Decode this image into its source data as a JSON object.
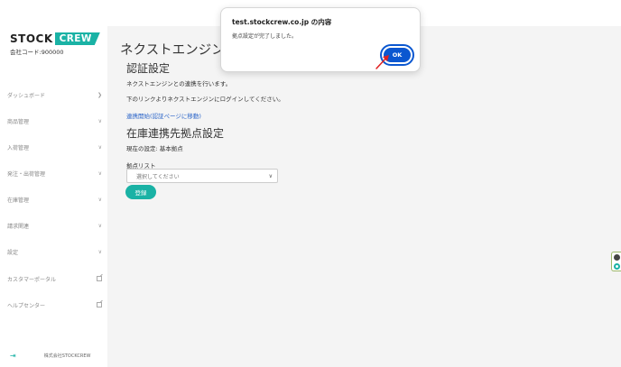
{
  "sidebar": {
    "logo_stock": "STOCK",
    "logo_crew": "CREW",
    "company_code": "会社コード:900000",
    "items": [
      {
        "label": "ダッシュボード",
        "icon": "chevron-right-icon"
      },
      {
        "label": "商品管理",
        "icon": "chevron-down-icon"
      },
      {
        "label": "入荷管理",
        "icon": "chevron-down-icon"
      },
      {
        "label": "発注・出荷管理",
        "icon": "chevron-down-icon"
      },
      {
        "label": "在庫管理",
        "icon": "chevron-down-icon"
      },
      {
        "label": "請求関連",
        "icon": "chevron-down-icon"
      },
      {
        "label": "設定",
        "icon": "chevron-down-icon"
      },
      {
        "label": "カスタマーポータル",
        "icon": "external-link-icon"
      },
      {
        "label": "ヘルプセンター",
        "icon": "external-link-icon"
      }
    ],
    "footer_company": "株式会社STOCKCREW"
  },
  "main": {
    "page_title": "ネクストエンジン 連",
    "auth_title": "認証設定",
    "auth_desc": "ネクストエンジンとの連携を行います。",
    "auth_instruction": "下のリンクよりネクストエンジンにログインしてください。",
    "auth_link": "連携開始(認証ページに移動)",
    "loc_title": "在庫連携先拠点設定",
    "current_setting": "現在の設定: 基本拠点",
    "list_label": "拠点リスト",
    "select_placeholder": "選択してください",
    "register_label": "登録"
  },
  "dialog": {
    "title": "test.stockcrew.co.jp の内容",
    "message": "拠点設定が完了しました。",
    "ok_label": "OK"
  },
  "colors": {
    "brand": "#1ab2a5",
    "ok_button": "#0b57d0",
    "link": "#2a64c8",
    "annotation": "#e02020"
  }
}
